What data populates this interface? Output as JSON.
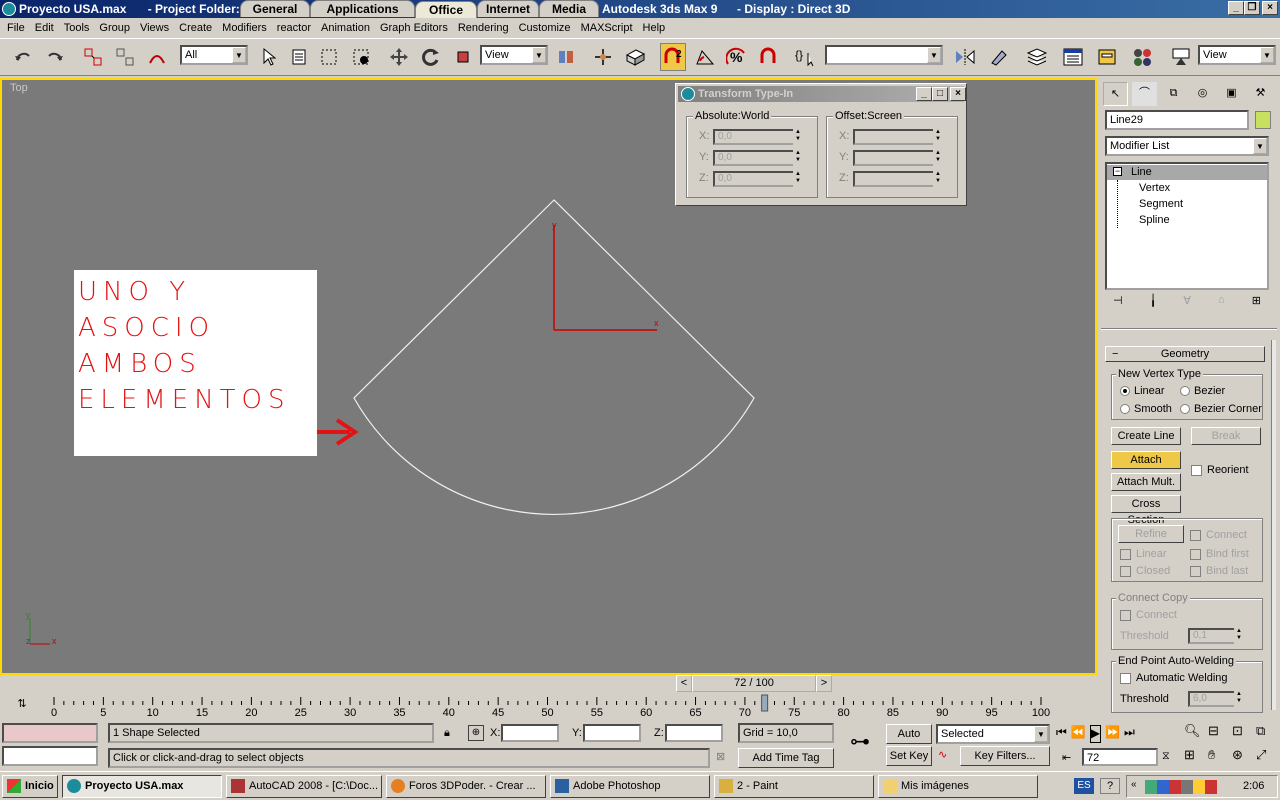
{
  "titlebar": {
    "file": "Proyecto USA.max",
    "project": "- Project Folder: C",
    "app": "Autodesk 3ds Max 9",
    "display": "- Display : Direct 3D",
    "tabs": [
      "General",
      "Applications",
      "Office",
      "Internet",
      "Media"
    ]
  },
  "menu": [
    "File",
    "Edit",
    "Tools",
    "Group",
    "Views",
    "Create",
    "Modifiers",
    "reactor",
    "Animation",
    "Graph Editors",
    "Rendering",
    "Customize",
    "MAXScript",
    "Help"
  ],
  "toolbar": {
    "filter_value": "All",
    "refcoord_value": "View",
    "named_sel_value": "",
    "view_value": "View",
    "snap_label": "2"
  },
  "viewport": {
    "label": "Top",
    "annotation": [
      "UNO Y",
      "ASOCIO",
      "AMBOS",
      "ELEMENTOS"
    ],
    "axis": {
      "x": "x",
      "y": "y",
      "z": "z"
    }
  },
  "transform_dialog": {
    "title": "Transform Type-In",
    "absolute_label": "Absolute:World",
    "offset_label": "Offset:Screen",
    "x": "X:",
    "y": "Y:",
    "z": "Z:",
    "abs_x": "0,0",
    "abs_y": "0,0",
    "abs_z": "0,0"
  },
  "panel": {
    "object_name": "Line29",
    "modifier_list": "Modifier List",
    "stack": [
      "Line",
      "Vertex",
      "Segment",
      "Spline"
    ],
    "rollout": "Geometry",
    "new_vertex_type": "New Vertex Type",
    "linear": "Linear",
    "bezier": "Bezier",
    "smooth": "Smooth",
    "bezier_corner": "Bezier Corner",
    "create_line": "Create Line",
    "break": "Break",
    "attach": "Attach",
    "reorient": "Reorient",
    "attach_mult": "Attach Mult.",
    "cross_section": "Cross Section",
    "refine": "Refine",
    "connect": "Connect",
    "linear2": "Linear",
    "bind_first": "Bind first",
    "closed": "Closed",
    "bind_last": "Bind last",
    "connect_copy": "Connect Copy",
    "connect2": "Connect",
    "threshold": "Threshold",
    "threshold_val": "0,1",
    "end_point": "End Point Auto-Welding",
    "auto_weld": "Automatic Welding",
    "threshold2": "Threshold",
    "threshold2_val": "6,0"
  },
  "timeline": {
    "frame": "72 / 100",
    "ticks": [
      "0",
      "5",
      "10",
      "15",
      "20",
      "25",
      "30",
      "35",
      "40",
      "45",
      "50",
      "55",
      "60",
      "65",
      "70",
      "75",
      "80",
      "85",
      "90",
      "95",
      "100"
    ],
    "current": 72,
    "total": 100
  },
  "status": {
    "selection": "1 Shape Selected",
    "prompt": "Click or click-and-drag to select objects",
    "x_label": "X:",
    "y_label": "Y:",
    "z_label": "Z:",
    "grid": "Grid = 10,0",
    "add_time_tag": "Add Time Tag",
    "auto_key": "Auto Key",
    "set_key": "Set Key",
    "selected_value": "Selected",
    "key_filters": "Key Filters...",
    "frame_value": "72"
  },
  "taskbar": {
    "start": "Inicio",
    "items": [
      "Proyecto USA.max",
      "AutoCAD 2008 - [C:\\Doc...",
      "Foros 3DPoder. - Crear ...",
      "Adobe Photoshop",
      "2 - Paint",
      "Mis imágenes"
    ],
    "lang": "ES",
    "clock": "2:06"
  }
}
